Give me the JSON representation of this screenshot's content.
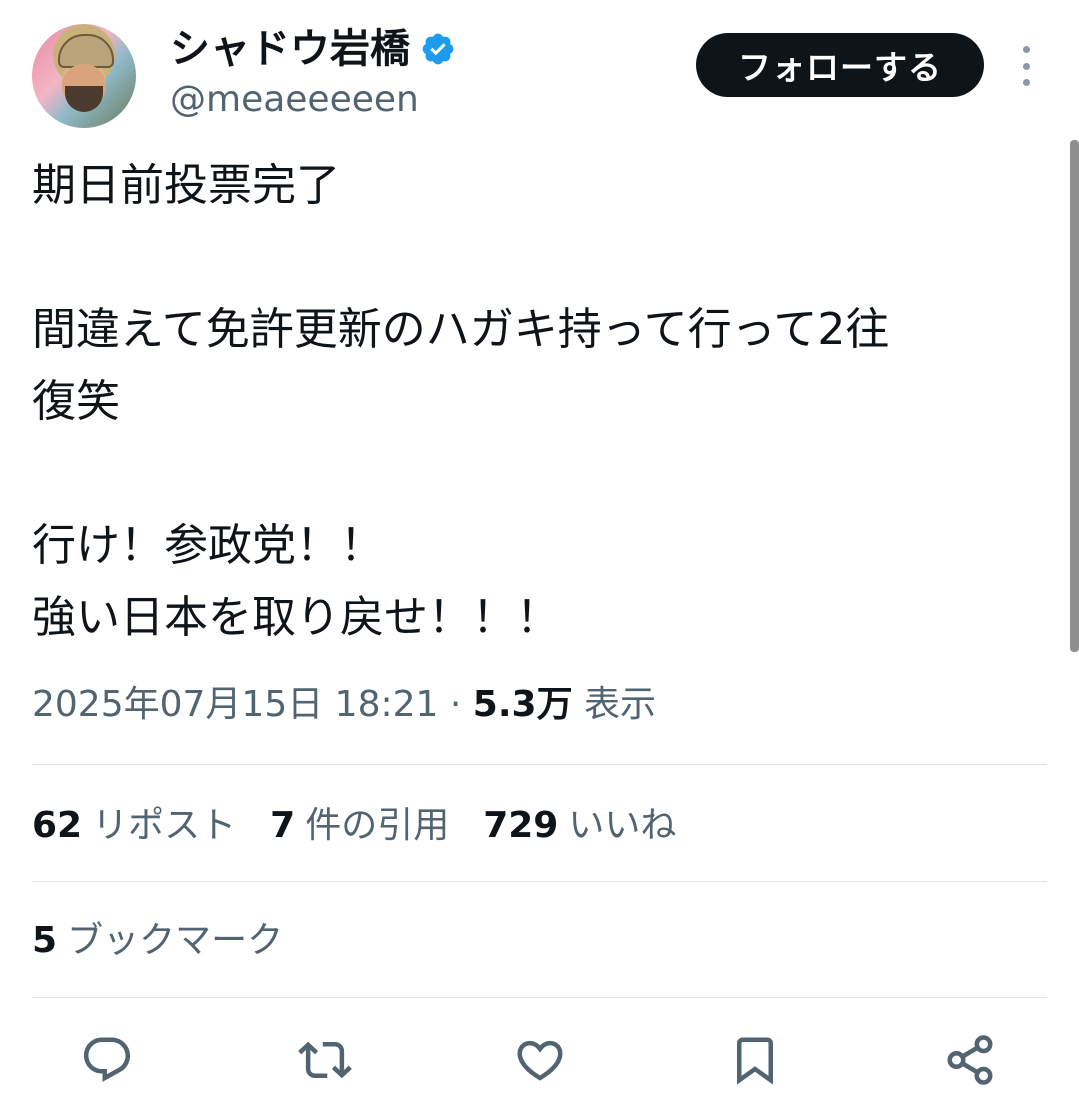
{
  "user": {
    "display_name": "シャドウ岩橋",
    "handle": "@meaeeeeen"
  },
  "header": {
    "follow_label": "フォローする"
  },
  "tweet": {
    "lines": [
      "期日前投票完了",
      "",
      "間違えて免許更新のハガキ持って行って2往",
      "復笑",
      "",
      "行け！参政党！！",
      "強い日本を取り戻せ！！！"
    ],
    "timestamp": "2025年07月15日 18:21",
    "separator": "·",
    "views_count": "5.3万",
    "views_label": "表示"
  },
  "stats": {
    "reposts_count": "62",
    "reposts_label": "リポスト",
    "quotes_count": "7",
    "quotes_label": "件の引用",
    "likes_count": "729",
    "likes_label": "いいね",
    "bookmarks_count": "5",
    "bookmarks_label": "ブックマーク"
  },
  "icons": {
    "verified": "verified-badge-icon",
    "reply": "reply-icon",
    "retweet": "retweet-icon",
    "like": "heart-icon",
    "bookmark": "bookmark-icon",
    "share": "share-icon",
    "more": "more-vertical-icon"
  },
  "colors": {
    "text": "#0f1419",
    "secondary": "#536471",
    "verified": "#1d9bf0",
    "follow_bg": "#0f1419",
    "icon": "#536471"
  }
}
